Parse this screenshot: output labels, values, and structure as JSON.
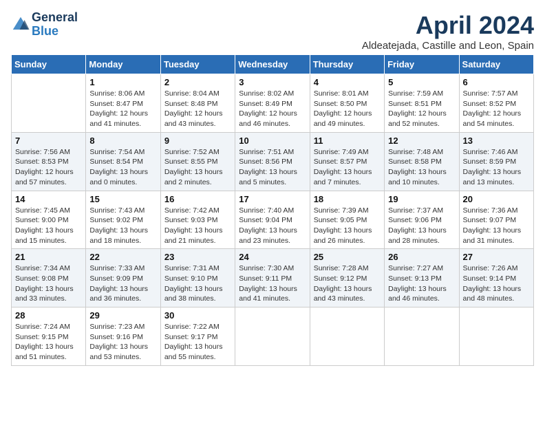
{
  "header": {
    "logo_general": "General",
    "logo_blue": "Blue",
    "month_title": "April 2024",
    "subtitle": "Aldeatejada, Castille and Leon, Spain"
  },
  "calendar": {
    "days_of_week": [
      "Sunday",
      "Monday",
      "Tuesday",
      "Wednesday",
      "Thursday",
      "Friday",
      "Saturday"
    ],
    "weeks": [
      [
        {
          "day": "",
          "info": ""
        },
        {
          "day": "1",
          "info": "Sunrise: 8:06 AM\nSunset: 8:47 PM\nDaylight: 12 hours\nand 41 minutes."
        },
        {
          "day": "2",
          "info": "Sunrise: 8:04 AM\nSunset: 8:48 PM\nDaylight: 12 hours\nand 43 minutes."
        },
        {
          "day": "3",
          "info": "Sunrise: 8:02 AM\nSunset: 8:49 PM\nDaylight: 12 hours\nand 46 minutes."
        },
        {
          "day": "4",
          "info": "Sunrise: 8:01 AM\nSunset: 8:50 PM\nDaylight: 12 hours\nand 49 minutes."
        },
        {
          "day": "5",
          "info": "Sunrise: 7:59 AM\nSunset: 8:51 PM\nDaylight: 12 hours\nand 52 minutes."
        },
        {
          "day": "6",
          "info": "Sunrise: 7:57 AM\nSunset: 8:52 PM\nDaylight: 12 hours\nand 54 minutes."
        }
      ],
      [
        {
          "day": "7",
          "info": "Sunrise: 7:56 AM\nSunset: 8:53 PM\nDaylight: 12 hours\nand 57 minutes."
        },
        {
          "day": "8",
          "info": "Sunrise: 7:54 AM\nSunset: 8:54 PM\nDaylight: 13 hours\nand 0 minutes."
        },
        {
          "day": "9",
          "info": "Sunrise: 7:52 AM\nSunset: 8:55 PM\nDaylight: 13 hours\nand 2 minutes."
        },
        {
          "day": "10",
          "info": "Sunrise: 7:51 AM\nSunset: 8:56 PM\nDaylight: 13 hours\nand 5 minutes."
        },
        {
          "day": "11",
          "info": "Sunrise: 7:49 AM\nSunset: 8:57 PM\nDaylight: 13 hours\nand 7 minutes."
        },
        {
          "day": "12",
          "info": "Sunrise: 7:48 AM\nSunset: 8:58 PM\nDaylight: 13 hours\nand 10 minutes."
        },
        {
          "day": "13",
          "info": "Sunrise: 7:46 AM\nSunset: 8:59 PM\nDaylight: 13 hours\nand 13 minutes."
        }
      ],
      [
        {
          "day": "14",
          "info": "Sunrise: 7:45 AM\nSunset: 9:00 PM\nDaylight: 13 hours\nand 15 minutes."
        },
        {
          "day": "15",
          "info": "Sunrise: 7:43 AM\nSunset: 9:02 PM\nDaylight: 13 hours\nand 18 minutes."
        },
        {
          "day": "16",
          "info": "Sunrise: 7:42 AM\nSunset: 9:03 PM\nDaylight: 13 hours\nand 21 minutes."
        },
        {
          "day": "17",
          "info": "Sunrise: 7:40 AM\nSunset: 9:04 PM\nDaylight: 13 hours\nand 23 minutes."
        },
        {
          "day": "18",
          "info": "Sunrise: 7:39 AM\nSunset: 9:05 PM\nDaylight: 13 hours\nand 26 minutes."
        },
        {
          "day": "19",
          "info": "Sunrise: 7:37 AM\nSunset: 9:06 PM\nDaylight: 13 hours\nand 28 minutes."
        },
        {
          "day": "20",
          "info": "Sunrise: 7:36 AM\nSunset: 9:07 PM\nDaylight: 13 hours\nand 31 minutes."
        }
      ],
      [
        {
          "day": "21",
          "info": "Sunrise: 7:34 AM\nSunset: 9:08 PM\nDaylight: 13 hours\nand 33 minutes."
        },
        {
          "day": "22",
          "info": "Sunrise: 7:33 AM\nSunset: 9:09 PM\nDaylight: 13 hours\nand 36 minutes."
        },
        {
          "day": "23",
          "info": "Sunrise: 7:31 AM\nSunset: 9:10 PM\nDaylight: 13 hours\nand 38 minutes."
        },
        {
          "day": "24",
          "info": "Sunrise: 7:30 AM\nSunset: 9:11 PM\nDaylight: 13 hours\nand 41 minutes."
        },
        {
          "day": "25",
          "info": "Sunrise: 7:28 AM\nSunset: 9:12 PM\nDaylight: 13 hours\nand 43 minutes."
        },
        {
          "day": "26",
          "info": "Sunrise: 7:27 AM\nSunset: 9:13 PM\nDaylight: 13 hours\nand 46 minutes."
        },
        {
          "day": "27",
          "info": "Sunrise: 7:26 AM\nSunset: 9:14 PM\nDaylight: 13 hours\nand 48 minutes."
        }
      ],
      [
        {
          "day": "28",
          "info": "Sunrise: 7:24 AM\nSunset: 9:15 PM\nDaylight: 13 hours\nand 51 minutes."
        },
        {
          "day": "29",
          "info": "Sunrise: 7:23 AM\nSunset: 9:16 PM\nDaylight: 13 hours\nand 53 minutes."
        },
        {
          "day": "30",
          "info": "Sunrise: 7:22 AM\nSunset: 9:17 PM\nDaylight: 13 hours\nand 55 minutes."
        },
        {
          "day": "",
          "info": ""
        },
        {
          "day": "",
          "info": ""
        },
        {
          "day": "",
          "info": ""
        },
        {
          "day": "",
          "info": ""
        }
      ]
    ]
  }
}
